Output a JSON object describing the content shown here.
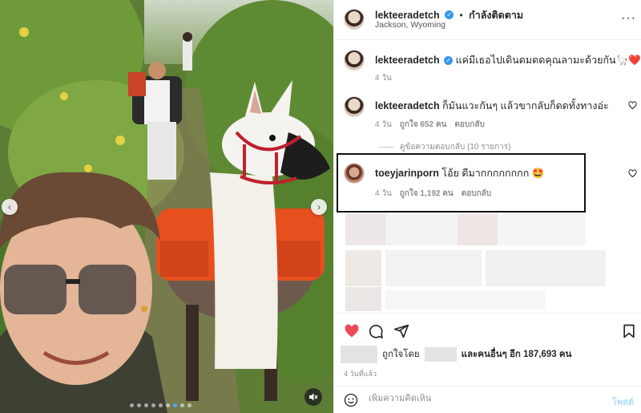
{
  "media": {
    "prev_arrow": "‹",
    "next_arrow": "›",
    "dots_count": 9,
    "active_dot": 6
  },
  "header": {
    "username": "lekteeradetch",
    "separator": "•",
    "follow_state": "กำลังติดตาม",
    "location": "Jackson, Wyoming",
    "more": "···"
  },
  "caption": {
    "username": "lekteeradetch",
    "text": "แค่มีเธอไปเดินดมดดคุณลามะด้วยกัน🦙❤️",
    "time": "4 วัน"
  },
  "comments": [
    {
      "username": "lekteeradetch",
      "text": "ก็มันแวะกันๆ แล้วขากลับก็ดดทั้งทางอ่ะ",
      "time": "4 วัน",
      "likes": "ถูกใจ 652 คน",
      "reply": "ตอบกลับ"
    },
    {
      "username": "toeyjarinporn",
      "text": "โอ้ย ดีมากกกกกกกก 🤩",
      "time": "4 วัน",
      "likes": "ถูกใจ 1,192 คน",
      "reply": "ตอบกลับ"
    }
  ],
  "view_replies": "ดูข้อความตอบกลับ (10 รายการ)",
  "likes_row": {
    "liked_by": "ถูกใจโดย",
    "and_others": "และคนอื่นๆ อีก 187,693 คน"
  },
  "time_ago": "4 วันที่แล้ว",
  "comment_box": {
    "placeholder": "เพิ่มความคิดเห็น",
    "post_label": "โพสต์"
  },
  "colors": {
    "like_red": "#ed4956",
    "verified_blue": "#3897f0",
    "post_disabled": "#b2dffc"
  }
}
